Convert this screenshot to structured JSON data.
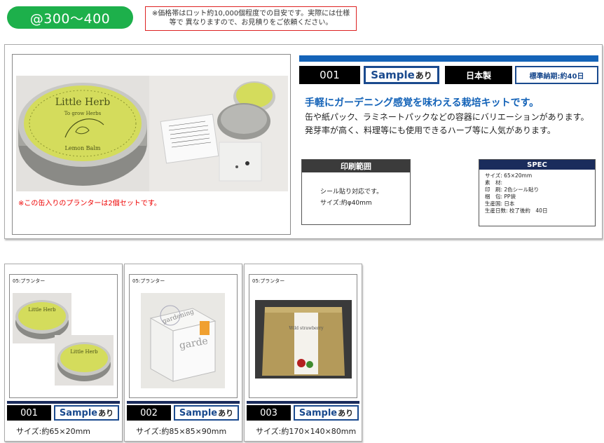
{
  "price": "@300〜400",
  "price_note": "※価格帯はロット約10,000個程度での目安です。実際には仕様等で 異なりますので、お見積りをご依頼ください。",
  "main_product": {
    "code": "001",
    "sample": "Sample",
    "sample_ari": "あり",
    "origin": "日本製",
    "lead_time": "標準納期:約40日",
    "headline": "手軽にガーデニング感覚を味わえる栽培キットです。",
    "desc_lines": [
      "缶や紙パック、ラミネートパックなどの容器にバリエーションがあります。",
      "発芽率が高く、料理等にも使用できるハーブ等に人気があります。"
    ],
    "photo_caption": "※この缶入りのプランターは2個セットです。",
    "tin_text_1": "Little Herb",
    "tin_text_2": "To grow Herbs",
    "tin_text_3": "Lemon Balm",
    "print_title": "印刷範囲",
    "print_lines": [
      "シール貼り対応です。",
      "サイズ:約φ40mm"
    ],
    "spec_title": "SPEC",
    "spec_lines": [
      "サイズ: 65×20mm",
      "素　材:",
      "印　刷: 2色シール貼り",
      "梱　包: PP袋",
      "生産国: 日本",
      "生産日数: 校了後約　40日"
    ]
  },
  "cards": [
    {
      "category": "05:プランター",
      "code": "001",
      "sample": "Sample",
      "sample_ari": "あり",
      "size": "サイズ:約65×20mm",
      "label_a": "Little Herb",
      "label_b": "Little Herb"
    },
    {
      "category": "05:プランター",
      "code": "002",
      "sample": "Sample",
      "sample_ari": "あり",
      "size": "サイズ:約85×85×90mm",
      "label_a": "gardening",
      "label_b": "garde"
    },
    {
      "category": "05:プランター",
      "code": "003",
      "sample": "Sample",
      "sample_ari": "あり",
      "size": "サイズ:約170×140×80mm",
      "label_a": "Wild strawberry",
      "label_b": ""
    }
  ],
  "colors": {
    "green": "#1db04b",
    "blue": "#1463b8",
    "navy": "#1a2c5c",
    "red": "#dd2222"
  }
}
